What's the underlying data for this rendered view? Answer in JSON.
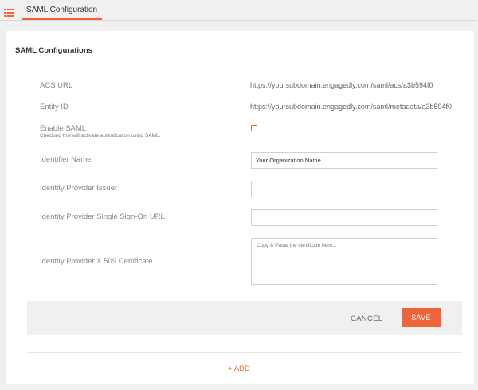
{
  "header": {
    "tab_label": "SAML Configuration"
  },
  "card": {
    "title": "SAML Configurations"
  },
  "fields": {
    "acs_url": {
      "label": "ACS URL",
      "value": "https://yoursubdomain.engagedly.com/saml/acs/a3b594f0"
    },
    "entity_id": {
      "label": "Entity ID",
      "value": "https://yoursubdomain.engagedly.com/saml/metadata/a3b594f0"
    },
    "enable_saml": {
      "label": "Enable SAML",
      "hint": "Checking this will activate autentication using SAML.",
      "checked": false
    },
    "identifier_name": {
      "label": "Identifier Name",
      "value": "Your Organization Name"
    },
    "idp_issuer": {
      "label": "Identity Provider Issuer",
      "value": ""
    },
    "idp_sso_url": {
      "label": "Identity Provider Single Sign-On URL",
      "value": ""
    },
    "idp_certificate": {
      "label": "Identity Provider X.509 Certificate",
      "placeholder": "Copy & Paste the certificate here..."
    }
  },
  "actions": {
    "cancel_label": "CANCEL",
    "save_label": "SAVE"
  },
  "add_label": "+ ADD",
  "colors": {
    "accent": "#f0643c",
    "background": "#f0f0f0",
    "card": "#ffffff"
  },
  "icons": {
    "header": "list-icon"
  }
}
